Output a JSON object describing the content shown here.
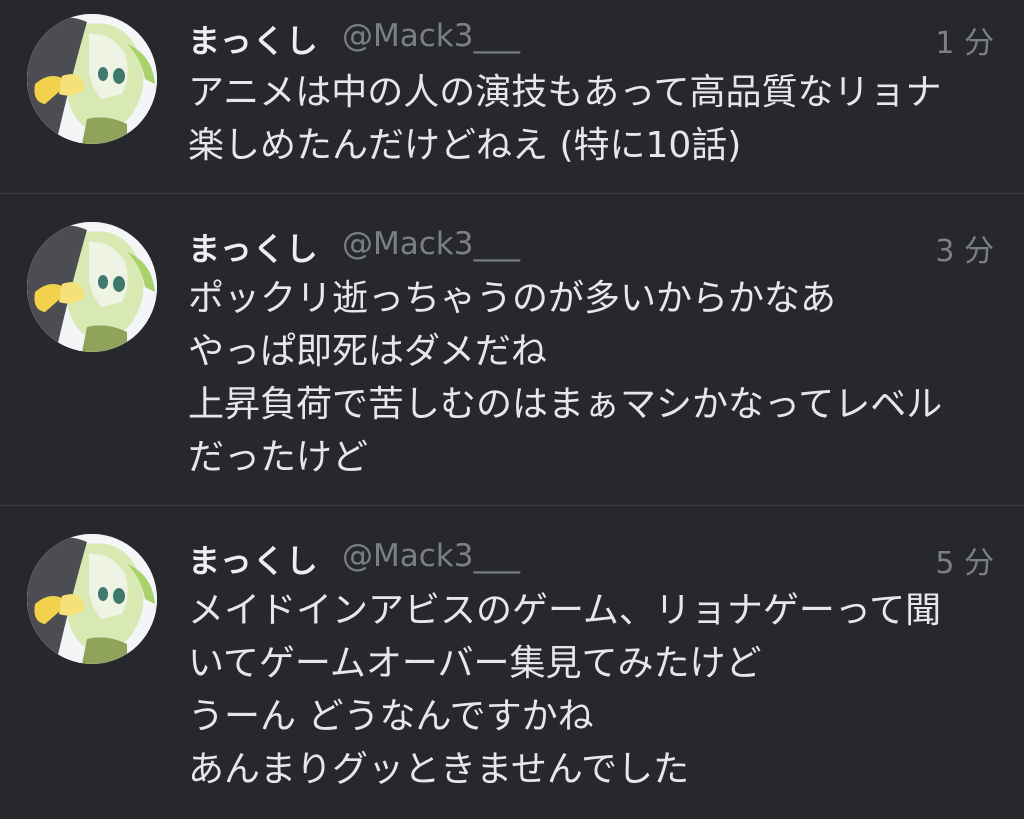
{
  "tweets": [
    {
      "display_name": "まっくし",
      "handle": "@Mack3___",
      "time": "1 分",
      "lines": [
        "アニメは中の人の演技もあって高品質なリョナ",
        "楽しめたんだけどねえ (特に10話)"
      ]
    },
    {
      "display_name": "まっくし",
      "handle": "@Mack3___",
      "time": "3 分",
      "lines": [
        "ポックリ逝っちゃうのが多いからかなあ",
        "やっぱ即死はダメだね",
        "上昇負荷で苦しむのはまぁマシかなってレベル",
        "だったけど"
      ]
    },
    {
      "display_name": "まっくし",
      "handle": "@Mack3___",
      "time": "5 分",
      "lines": [
        "メイドインアビスのゲーム、リョナゲーって聞",
        "いてゲームオーバー集見てみたけど",
        "うーん どうなんですかね",
        "あんまりグッときませんでした"
      ]
    }
  ],
  "colors": {
    "background": "#26282e",
    "divider": "#3a3d45",
    "primary_text": "#e6e7eb",
    "secondary_text": "#7c7f88"
  }
}
